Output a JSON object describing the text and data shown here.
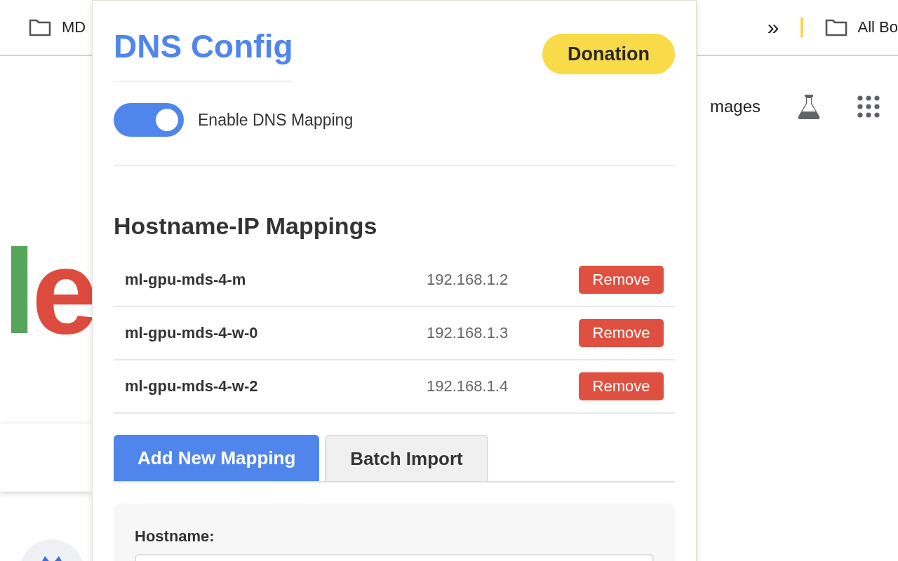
{
  "browser": {
    "bookmarks_left": [
      {
        "label": "MD"
      }
    ],
    "overflow": "»",
    "bookmarks_right": [
      {
        "label": "All Bo"
      }
    ],
    "toolbar_text": "mages",
    "logo_letters": [
      {
        "text": "l",
        "color": "#57a55a"
      },
      {
        "text": "e",
        "color": "#dd4b3e"
      }
    ]
  },
  "popup": {
    "title": "DNS Config",
    "donation": "Donation",
    "toggle": {
      "label": "Enable DNS Mapping",
      "on": true
    },
    "heading": "Hostname-IP Mappings",
    "mappings": [
      {
        "hostname": "ml-gpu-mds-4-m",
        "ip": "192.168.1.2",
        "action": "Remove"
      },
      {
        "hostname": "ml-gpu-mds-4-w-0",
        "ip": "192.168.1.3",
        "action": "Remove"
      },
      {
        "hostname": "ml-gpu-mds-4-w-2",
        "ip": "192.168.1.4",
        "action": "Remove"
      }
    ],
    "tabs": [
      {
        "label": "Add New Mapping",
        "selected": true
      },
      {
        "label": "Batch Import",
        "selected": false
      }
    ],
    "form": {
      "label": "Hostname:"
    }
  }
}
